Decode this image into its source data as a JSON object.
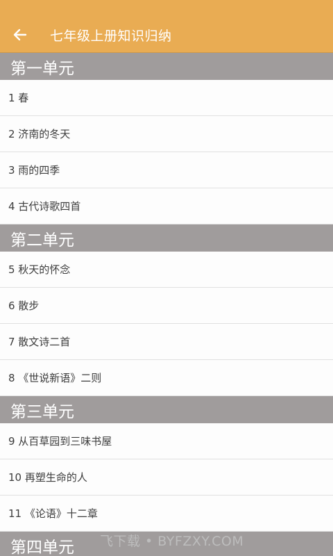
{
  "header": {
    "back_icon": "arrow-left-icon",
    "title": "七年级上册知识归纳"
  },
  "sections": [
    {
      "title": "第一单元",
      "items": [
        "1 春",
        "2 济南的冬天",
        "3 雨的四季",
        "4 古代诗歌四首"
      ]
    },
    {
      "title": "第二单元",
      "items": [
        "5 秋天的怀念",
        "6 散步",
        "7 散文诗二首",
        "8 《世说新语》二则"
      ]
    },
    {
      "title": "第三单元",
      "items": [
        "9 从百草园到三味书屋",
        "10 再塑生命的人",
        "11 《论语》十二章"
      ]
    },
    {
      "title": "第四单元",
      "items": []
    }
  ],
  "watermark": "飞下载 • BYFZXY.COM",
  "colors": {
    "app_bar": "#e9ac53",
    "section_header": "#a09c9c",
    "item_text": "#3c3c3c",
    "divider": "#e0e0e0"
  }
}
